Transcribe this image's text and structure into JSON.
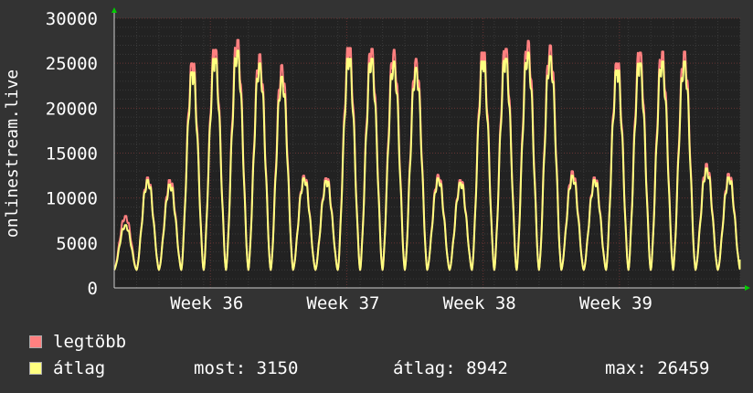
{
  "colors": {
    "background": "#333333",
    "plot_background": "#222222",
    "grid_minor": "#3a3a3a",
    "grid_major": "#663333",
    "max_line": "#ff8080",
    "avg_line": "#ffff80",
    "axis_arrow": "#00cc00",
    "text": "#ffffff"
  },
  "legend": {
    "items": [
      {
        "label": "legtöbb",
        "color": "#ff8080"
      },
      {
        "label": "átlag",
        "color": "#ffff80"
      }
    ]
  },
  "stats": {
    "current": "most: 3150",
    "average": "átlag: 8942",
    "maximum": "max: 26459"
  },
  "chart_data": {
    "type": "line",
    "ylabel": "onlinestream.live",
    "xlabel": "",
    "ylim": [
      0,
      30000
    ],
    "y_ticks": [
      "0",
      "5000",
      "10000",
      "15000",
      "20000",
      "25000",
      "30000"
    ],
    "x_tick_labels": [
      "Week 36",
      "Week 37",
      "Week 38",
      "Week 39"
    ],
    "x_range_days": [
      0,
      28
    ],
    "x_tick_positions_days": [
      4.3,
      10.4,
      16.5,
      22.6
    ],
    "grid": true,
    "series": [
      {
        "name": "legtöbb",
        "color": "#ff8080",
        "daily_peaks": [
          8000,
          12300,
          12000,
          25000,
          26500,
          27600,
          26000,
          24800,
          12500,
          12200,
          26700,
          26600,
          26500,
          25500,
          12600,
          12000,
          26200,
          26600,
          27500,
          27000,
          13000,
          12300,
          25000,
          26200,
          26300,
          26300,
          13800,
          12700
        ]
      },
      {
        "name": "átlag",
        "color": "#ffff80",
        "daily_peaks": [
          7000,
          12000,
          11500,
          24000,
          25500,
          26400,
          25000,
          23500,
          12200,
          11900,
          25500,
          25500,
          25200,
          24500,
          12200,
          11700,
          25200,
          25500,
          26200,
          25800,
          12500,
          12000,
          24200,
          25000,
          25200,
          25200,
          13300,
          12300
        ]
      }
    ],
    "daily_trough": 2000,
    "last_value": 3150
  }
}
